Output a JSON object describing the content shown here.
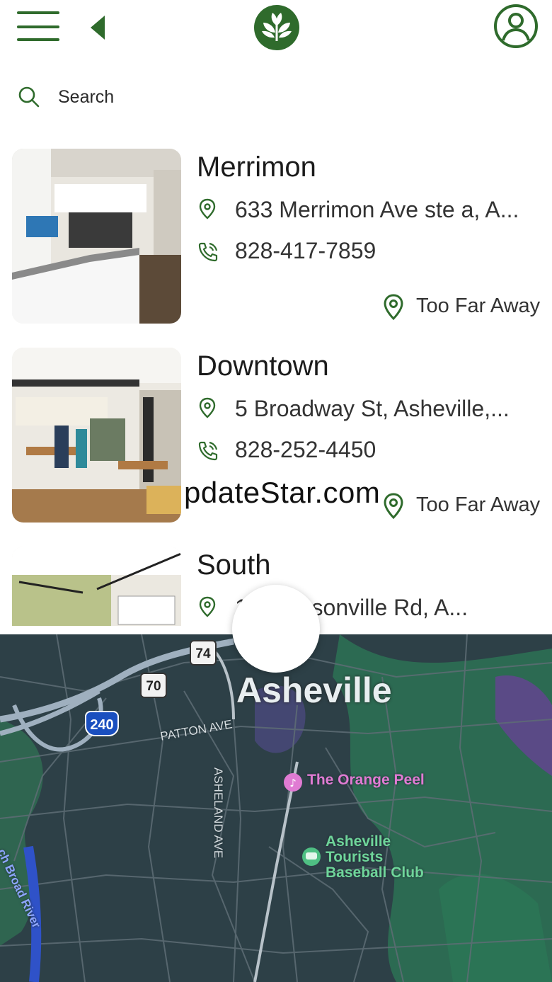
{
  "header": {
    "menu_icon": "hamburger-menu-icon",
    "back_icon": "back-triangle-icon",
    "logo_icon": "leaf-logo-icon",
    "profile_icon": "user-profile-icon",
    "accent_color": "#2f6b2c"
  },
  "search": {
    "placeholder": "Search",
    "value": "",
    "icon": "search-icon"
  },
  "locations": [
    {
      "name": "Merrimon",
      "address": "633 Merrimon Ave ste a, A...",
      "phone": "828-417-7859",
      "distance_status": "Too Far Away"
    },
    {
      "name": "Downtown",
      "address": "5 Broadway St, Asheville,...",
      "phone": "828-252-4450",
      "distance_status": "Too Far Away"
    },
    {
      "name": "South",
      "address": "1   endersonville Rd, A..."
    }
  ],
  "watermark": "pdateStar.com",
  "map": {
    "city": "Asheville",
    "poi_orange_peel": "The Orange Peel",
    "poi_tourists_line1": "Asheville",
    "poi_tourists_line2": "Tourists",
    "poi_tourists_line3": "Baseball Club",
    "road_patton": "PATTON AVE",
    "road_asheland": "ASHELAND AVE",
    "river": "ch Broad River",
    "shield_us70": "70",
    "shield_us74": "74",
    "shield_i240": "240"
  }
}
